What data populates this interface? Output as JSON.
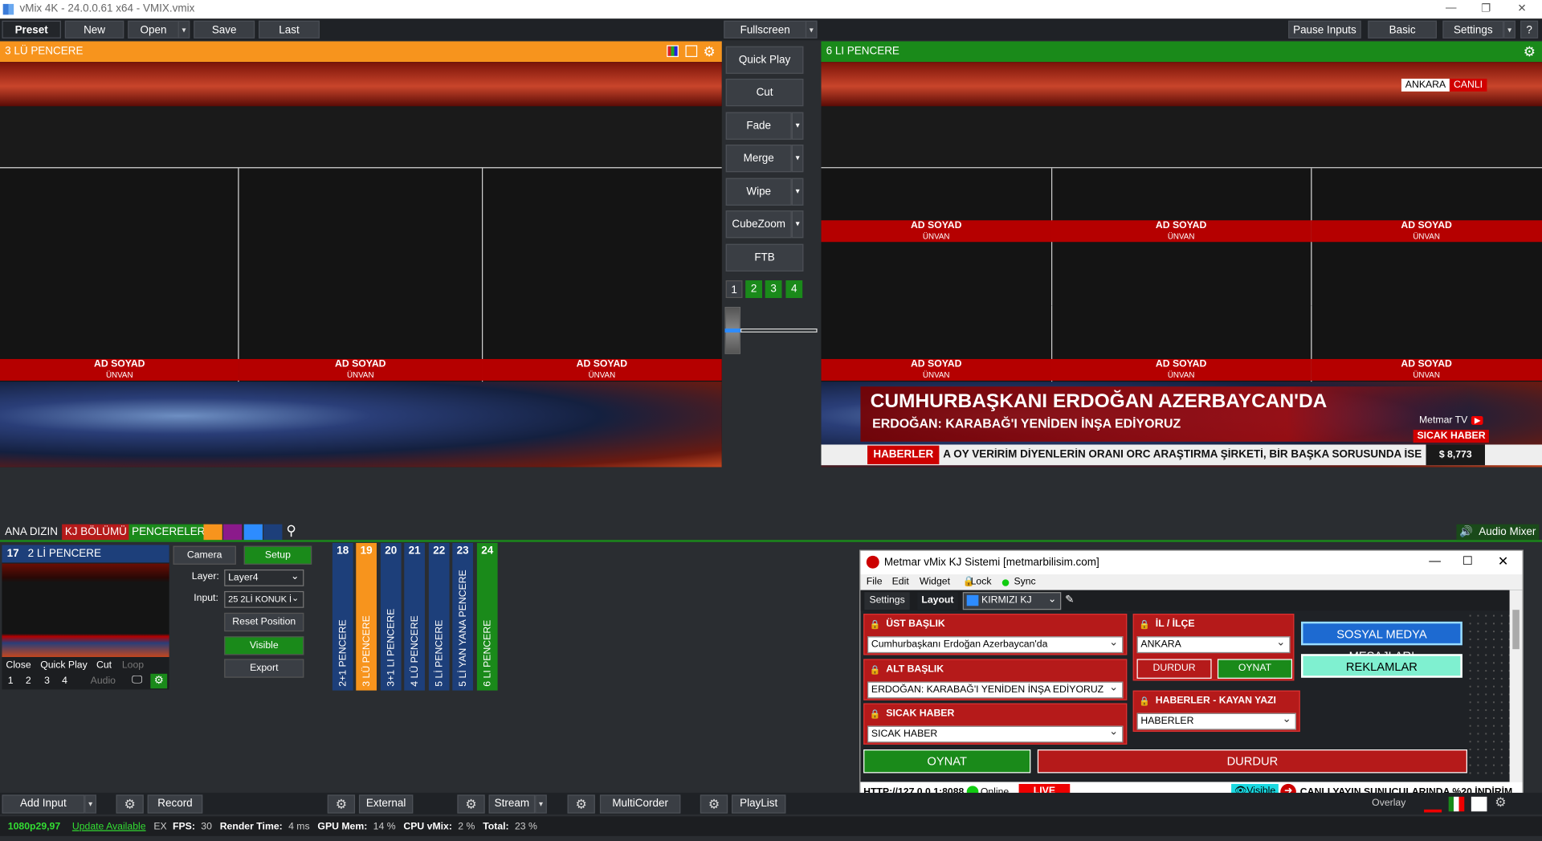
{
  "app": {
    "title": "vMix 4K - 24.0.0.61 x64 - VMIX.vmix"
  },
  "toolbar": {
    "preset": "Preset",
    "new": "New",
    "open": "Open",
    "save": "Save",
    "last": "Last",
    "fullscreen": "Fullscreen",
    "pause_inputs": "Pause Inputs",
    "basic": "Basic",
    "settings": "Settings",
    "help": "?"
  },
  "preview": {
    "title": "3 LÜ PENCERE",
    "plates": [
      {
        "name": "AD SOYAD",
        "title": "ÜNVAN"
      },
      {
        "name": "AD SOYAD",
        "title": "ÜNVAN"
      },
      {
        "name": "AD SOYAD",
        "title": "ÜNVAN"
      }
    ]
  },
  "output": {
    "title": "6 LI PENCERE",
    "city": "ANKARA",
    "live": "CANLI",
    "plates": [
      {
        "name": "AD SOYAD",
        "title": "ÜNVAN"
      },
      {
        "name": "AD SOYAD",
        "title": "ÜNVAN"
      },
      {
        "name": "AD SOYAD",
        "title": "ÜNVAN"
      },
      {
        "name": "AD SOYAD",
        "title": "ÜNVAN"
      },
      {
        "name": "AD SOYAD",
        "title": "ÜNVAN"
      },
      {
        "name": "AD SOYAD",
        "title": "ÜNVAN"
      }
    ],
    "headline": "CUMHURBAŞKANI ERDOĞAN AZERBAYCAN'DA",
    "subheadline": "ERDOĞAN: KARABAĞ'I YENİDEN İNŞA EDİYORUZ",
    "channel": "Metmar TV",
    "breaking": "SICAK HABER",
    "ticker_label": "HABERLER",
    "ticker_text": "A OY VERİRİM DİYENLERİN ORANI ORC ARAŞTIRMA ŞİRKETİ, BİR BAŞKA SORUSUNDA İSE",
    "price": "$ 8,773"
  },
  "transitions": {
    "quick_play": "Quick Play",
    "cut": "Cut",
    "fade": "Fade",
    "merge": "Merge",
    "wipe": "Wipe",
    "cubezoom": "CubeZoom",
    "ftb": "FTB",
    "numbers": [
      "1",
      "2",
      "3",
      "4"
    ]
  },
  "tabs": {
    "ana_dizin": "ANA DIZIN",
    "kj": "KJ BÖLÜMÜ",
    "pencereler": "PENCERELER",
    "audio_mixer": "Audio Mixer"
  },
  "input17": {
    "number": "17",
    "name": "2 Lİ PENCERE",
    "close": "Close",
    "quick_play": "Quick Play",
    "cut": "Cut",
    "loop": "Loop",
    "nums": [
      "1",
      "2",
      "3",
      "4"
    ],
    "audio": "Audio"
  },
  "layer_panel": {
    "camera": "Camera",
    "setup": "Setup",
    "layer_label": "Layer:",
    "layer_value": "Layer4",
    "input_label": "Input:",
    "input_value": "25 2Lİ KONUK İ",
    "reset": "Reset Position",
    "visible": "Visible",
    "export": "Export"
  },
  "inputs": [
    {
      "num": "18",
      "label": "2+1 PENCERE",
      "color": "#1d3f7a"
    },
    {
      "num": "19",
      "label": "3 LÜ PENCERE",
      "color": "#f7941d"
    },
    {
      "num": "20",
      "label": "3+1 LI PENCERE",
      "color": "#1d3f7a"
    },
    {
      "num": "21",
      "label": "4 LÜ PENCERE",
      "color": "#1d3f7a"
    },
    {
      "num": "22",
      "label": "5 Lİ PENCERE",
      "color": "#1d3f7a"
    },
    {
      "num": "23",
      "label": "5 Lİ YAN YANA PENCERE",
      "color": "#1d3f7a"
    },
    {
      "num": "24",
      "label": "6 LI PENCERE",
      "color": "#1a8a1a"
    }
  ],
  "kj": {
    "title": "Metmar vMix KJ Sistemi [metmarbilisim.com]",
    "menu": {
      "file": "File",
      "edit": "Edit",
      "widget": "Widget",
      "lock": "Lock",
      "sync": "Sync"
    },
    "tabs": {
      "settings": "Settings",
      "layout": "Layout",
      "theme": "KIRMIZI KJ"
    },
    "ust_baslik": {
      "label": "ÜST BAŞLIK",
      "value": "Cumhurbaşkanı Erdoğan Azerbaycan'da"
    },
    "alt_baslik": {
      "label": "ALT BAŞLIK",
      "value": "ERDOĞAN: KARABAĞ'I YENİDEN İNŞA EDİYORUZ"
    },
    "sicak_haber": {
      "label": "SICAK HABER",
      "value": "SICAK HABER"
    },
    "il_ilce": {
      "label": "İL / İLÇE",
      "value": "ANKARA",
      "stop": "DURDUR",
      "play": "OYNAT"
    },
    "haberler": {
      "label": "HABERLER - KAYAN YAZI",
      "value": "HABERLER"
    },
    "sosyal": "SOSYAL MEDYA MESAJLARI",
    "reklamlar": "REKLAMLAR",
    "play": "OYNAT",
    "stop": "DURDUR",
    "footer": {
      "url": "HTTP://127.0.0.1:8088",
      "online": "Online",
      "live": "LIVE",
      "visible": "Visible",
      "promo": "CANLI YAYIN SUNUCULARINDA %20 İNDİRİM"
    }
  },
  "bottombar": {
    "add_input": "Add Input",
    "record": "Record",
    "external": "External",
    "stream": "Stream",
    "multicorder": "MultiCorder",
    "playlist": "PlayList",
    "overlay": "Overlay"
  },
  "status": {
    "resolution": "1080p29,97",
    "update": "Update Available",
    "ex": "EX",
    "fps_label": "FPS:",
    "fps": "30",
    "render_label": "Render Time:",
    "render": "4 ms",
    "gpu_label": "GPU Mem:",
    "gpu": "14 %",
    "cpu_label": "CPU vMix:",
    "cpu": "2 %",
    "total_label": "Total:",
    "total": "23 %"
  }
}
